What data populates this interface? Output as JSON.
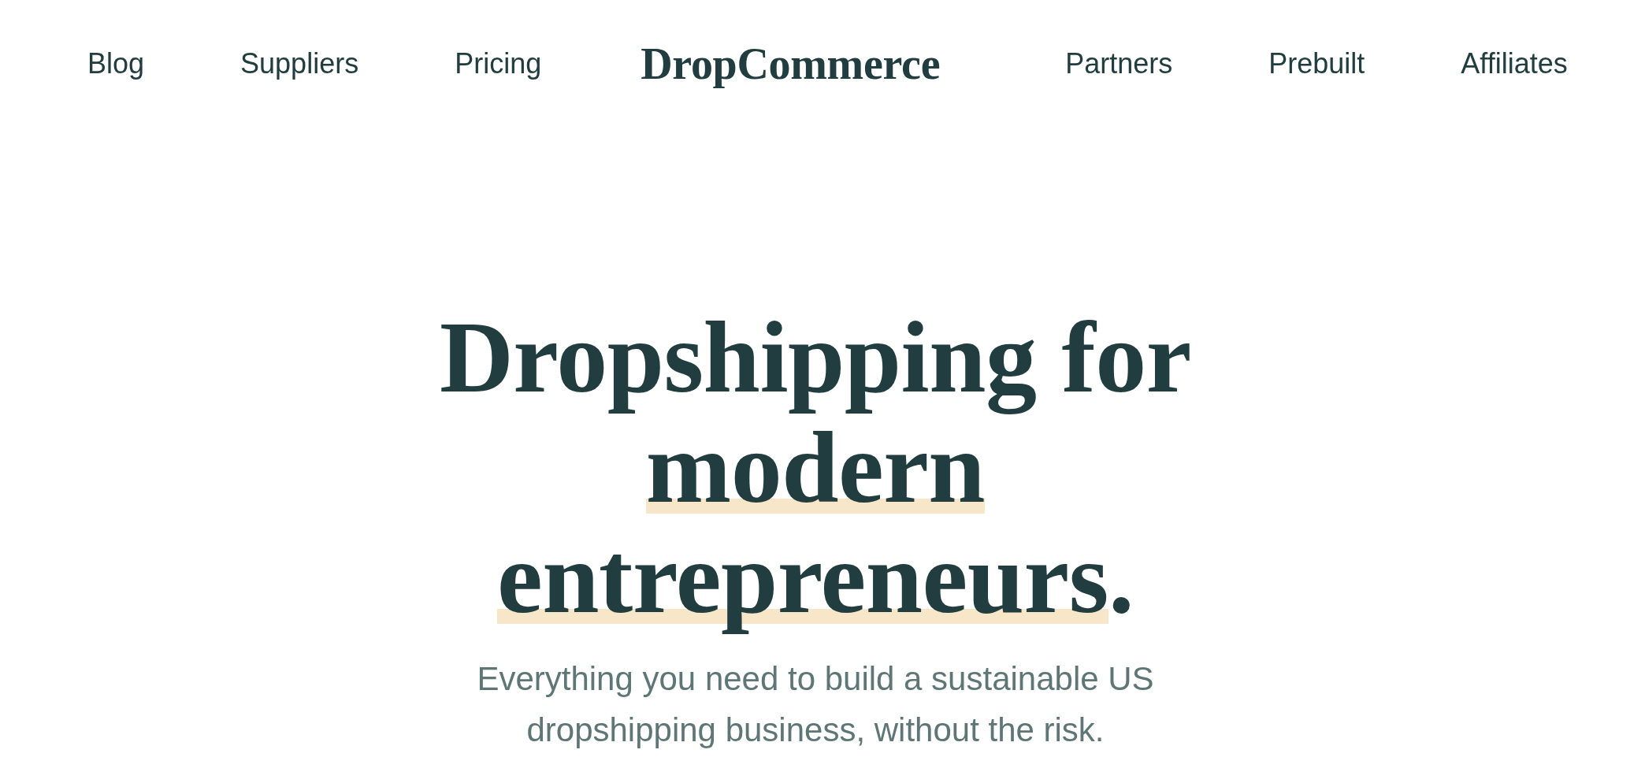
{
  "nav": {
    "left_links": [
      "Blog",
      "Suppliers",
      "Pricing"
    ],
    "logo": "DropCommerce",
    "right_links": [
      "Partners",
      "Prebuilt",
      "Affiliates"
    ]
  },
  "hero": {
    "headline": [
      {
        "text": "Dropshipping for ",
        "highlighted": false
      },
      {
        "text": "modern ",
        "highlighted": true
      },
      {
        "text": "entrepreneurs",
        "highlighted": true
      },
      {
        "text": ".",
        "highlighted": false
      }
    ],
    "subtitle": "Everything you need to build a sustainable US dropshipping business, without the risk."
  }
}
